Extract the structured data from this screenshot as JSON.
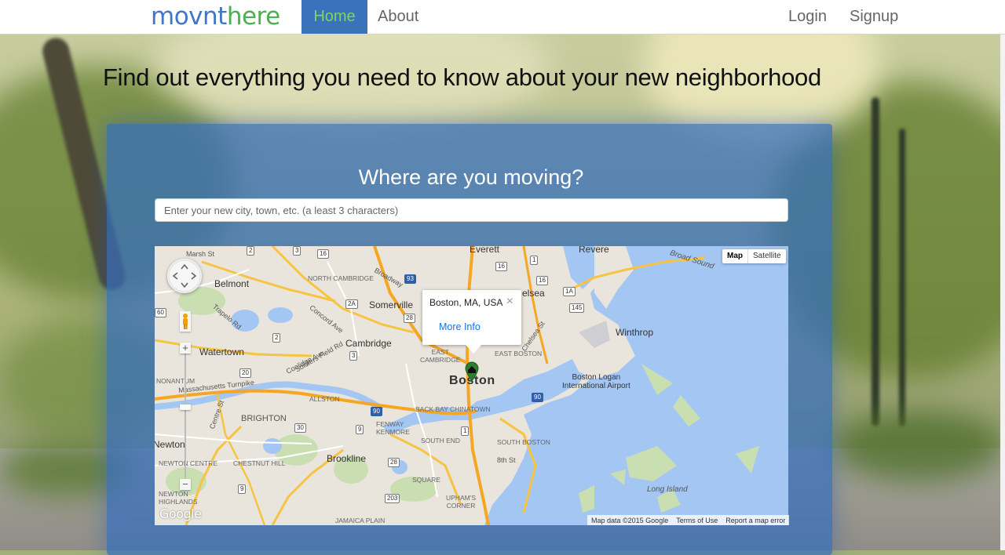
{
  "navbar": {
    "brand_left": "movnt",
    "brand_accent": "here",
    "items": [
      {
        "label": "Home",
        "active": true
      },
      {
        "label": "About"
      },
      {
        "label": "Login"
      },
      {
        "label": "Signup"
      }
    ]
  },
  "headline": "Find out everything you need to know about your new neighborhood",
  "search": {
    "title": "Where are you moving?",
    "placeholder": "Enter your new city, town, etc. (a least 3 characters)"
  },
  "map": {
    "type_buttons": [
      "Map",
      "Satellite"
    ],
    "popup": {
      "title": "Boston, MA, USA",
      "close": "×",
      "link": "More Info"
    },
    "labels": {
      "marsh": "Marsh St",
      "belmont": "Belmont",
      "north_cambridge": "NORTH CAMBRIDGE",
      "somerville": "Somerville",
      "everett": "Everett",
      "revere": "Revere",
      "chelsea": "elsea",
      "broad_sound": "Broad Sound",
      "cambridge": "Cambridge",
      "watertown": "Watertown",
      "boston": "Boston",
      "winthrop": "Winthrop",
      "airport": "Boston Logan\nInternational Airport",
      "brighton": "BRIGHTON",
      "allston": "ALLSTON",
      "newton": "Newton",
      "brookline": "Brookline",
      "chestnut_hill": "CHESTNUT HILL",
      "newton_centre": "NEWTON CENTRE",
      "newton_highlands": "NEWTON\nHIGHLANDS",
      "south_end": "SOUTH END",
      "south_boston": "SOUTH BOSTON",
      "back_bay": "BACK BAY",
      "chinatown": "CHINATOWN",
      "fenway": "FENWAY\nKENMORE",
      "long_island": "Long Island",
      "east_boston": "EAST BOSTON",
      "east_cambridge": "EAST\nCAMBRIDGE",
      "mass_pike": "Massachusetts Turnpike",
      "soldiers": "Soldiers Field Rd",
      "jamaica_plain": "JAMAICA PLAIN",
      "uphams": "UPHAM'S\nCORNER",
      "south_square": "SQUARE",
      "nonantum": "NONANTUM",
      "concord": "Concord Ave",
      "trapelo": "Trapelo Rd",
      "broadway": "Broadway",
      "coolidge": "Coolidge Ave",
      "rd": "Rd",
      "centre": "Centre St",
      "bennington": "Chelsea St",
      "eighth": "8th St"
    },
    "shields": [
      "2",
      "3",
      "16",
      "93",
      "1",
      "16",
      "16",
      "2A",
      "60",
      "28",
      "2",
      "20",
      "3",
      "90",
      "90",
      "1",
      "30",
      "9",
      "9",
      "203",
      "28",
      "1A",
      "145"
    ],
    "footer": [
      "Map data ©2015 Google",
      "Terms of Use",
      "Report a map error"
    ],
    "google_logo": "Google"
  }
}
